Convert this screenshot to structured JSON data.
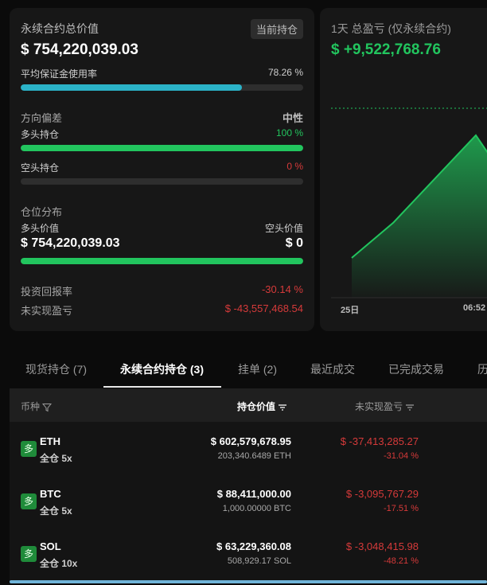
{
  "summary": {
    "title": "永续合约总价值",
    "badge": "当前持仓",
    "total_value": "$ 754,220,039.03",
    "margin_label": "平均保证金使用率",
    "margin_percent": "78.26 %",
    "margin_fraction": 0.7826,
    "margin_color": "#2bb3c8",
    "bias_label": "方向偏差",
    "bias_value": "中性",
    "long_label": "多头持仓",
    "long_percent": "100 %",
    "long_fraction": 1.0,
    "short_label": "空头持仓",
    "short_percent": "0 %",
    "short_fraction": 0.0,
    "distribution_label": "仓位分布",
    "long_value_label": "多头价值",
    "short_value_label": "空头价值",
    "long_value": "$ 754,220,039.03",
    "short_value": "$ 0",
    "distribution_long_fraction": 1.0,
    "roi_label": "投资回报率",
    "roi_value": "-30.14 %",
    "unrealized_label": "未实现盈亏",
    "unrealized_value": "$ -43,557,468.54",
    "accent_green": "#22c55e",
    "accent_red": "#d63a3a"
  },
  "pnl_card": {
    "title": "1天 总盈亏 (仅永续合约)",
    "value": "$ +9,522,768.76",
    "x_ticks": [
      "25日",
      "06:52"
    ]
  },
  "tabs": [
    {
      "label": "现货持仓 (7)"
    },
    {
      "label": "永续合约持仓 (3)"
    },
    {
      "label": "挂单 (2)"
    },
    {
      "label": "最近成交"
    },
    {
      "label": "已完成交易"
    },
    {
      "label": "历"
    }
  ],
  "table": {
    "headers": {
      "coin": "币种",
      "position_value": "持仓价值",
      "unrealized_pnl": "未实现盈亏"
    },
    "rows": [
      {
        "side": "多",
        "symbol": "ETH",
        "leverage": "全仓 5x",
        "value": "$ 602,579,678.95",
        "size": "203,340.6489 ETH",
        "pnl": "$ -37,413,285.27",
        "pnl_pct": "-31.04 %"
      },
      {
        "side": "多",
        "symbol": "BTC",
        "leverage": "全仓 5x",
        "value": "$ 88,411,000.00",
        "size": "1,000.00000 BTC",
        "pnl": "$ -3,095,767.29",
        "pnl_pct": "-17.51 %"
      },
      {
        "side": "多",
        "symbol": "SOL",
        "leverage": "全仓 10x",
        "value": "$ 63,229,360.08",
        "size": "508,929.17 SOL",
        "pnl": "$ -3,048,415.98",
        "pnl_pct": "-48.21 %"
      }
    ]
  }
}
